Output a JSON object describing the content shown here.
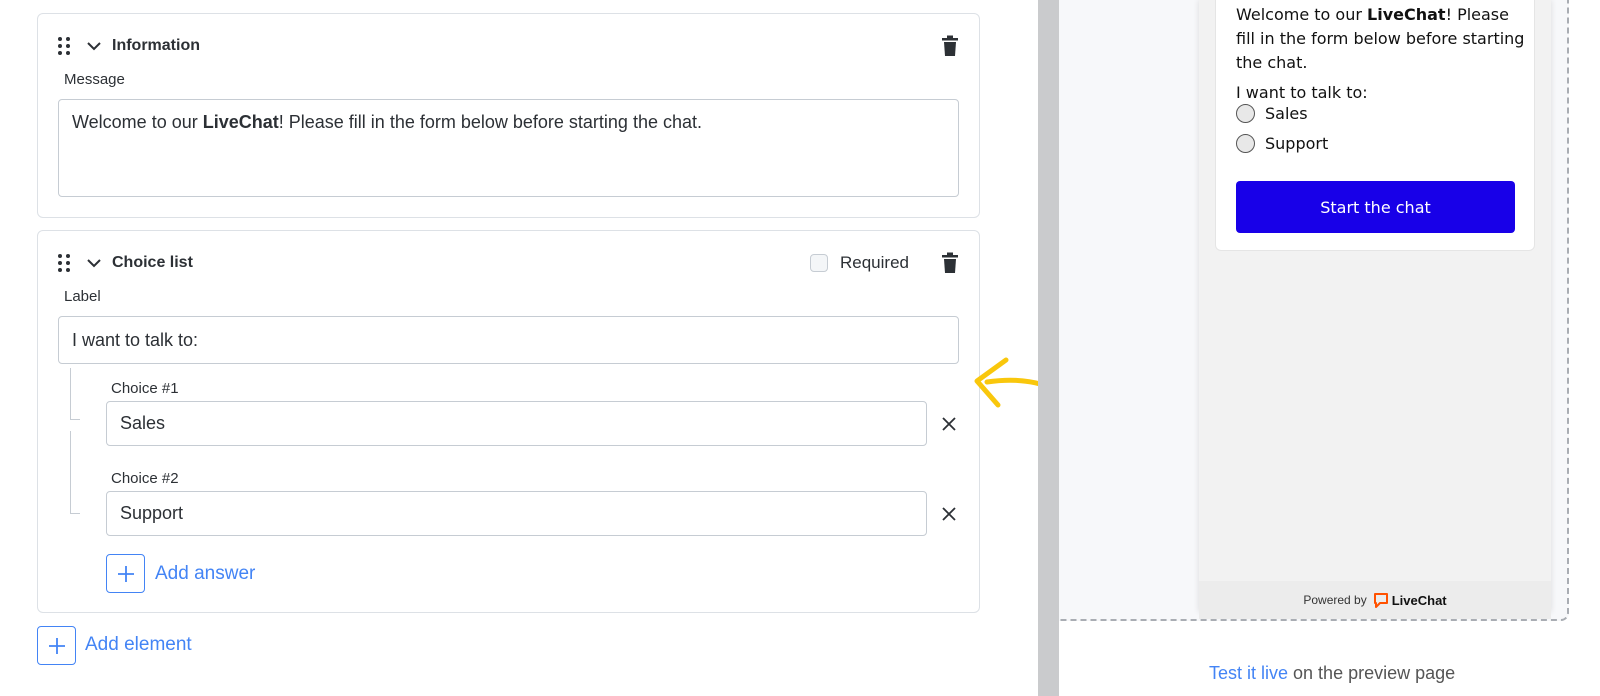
{
  "info_card": {
    "title": "Information",
    "message_label": "Message",
    "message_pre": "Welcome to our ",
    "message_bold": "LiveChat",
    "message_post": "! Please fill in the form below before starting the chat."
  },
  "choice_card": {
    "title": "Choice list",
    "required_label": "Required",
    "label_label": "Label",
    "label_value": "I want to talk to:",
    "choices": [
      {
        "label": "Choice #1",
        "value": "Sales"
      },
      {
        "label": "Choice #2",
        "value": "Support"
      }
    ],
    "add_answer": "Add answer"
  },
  "add_element": "Add element",
  "preview": {
    "msg_pre": "Welcome to our ",
    "msg_bold": "LiveChat",
    "msg_post": "! Please fill in the form below before starting the chat.",
    "question": "I want to talk to:",
    "options": [
      "Sales",
      "Support"
    ],
    "button": "Start the chat",
    "powered_by": "Powered by",
    "brand": "LiveChat"
  },
  "test_link": "Test it live",
  "test_suffix": " on the preview page",
  "colors": {
    "accent": "#4384f5",
    "widget_button": "#1800e8",
    "arrow": "#f9c70c",
    "brand_logo": "#ff5100"
  },
  "icons": [
    "drag-handle-icon",
    "chevron-down-icon",
    "trash-icon",
    "close-icon",
    "plus-icon",
    "livechat-logo-icon"
  ]
}
